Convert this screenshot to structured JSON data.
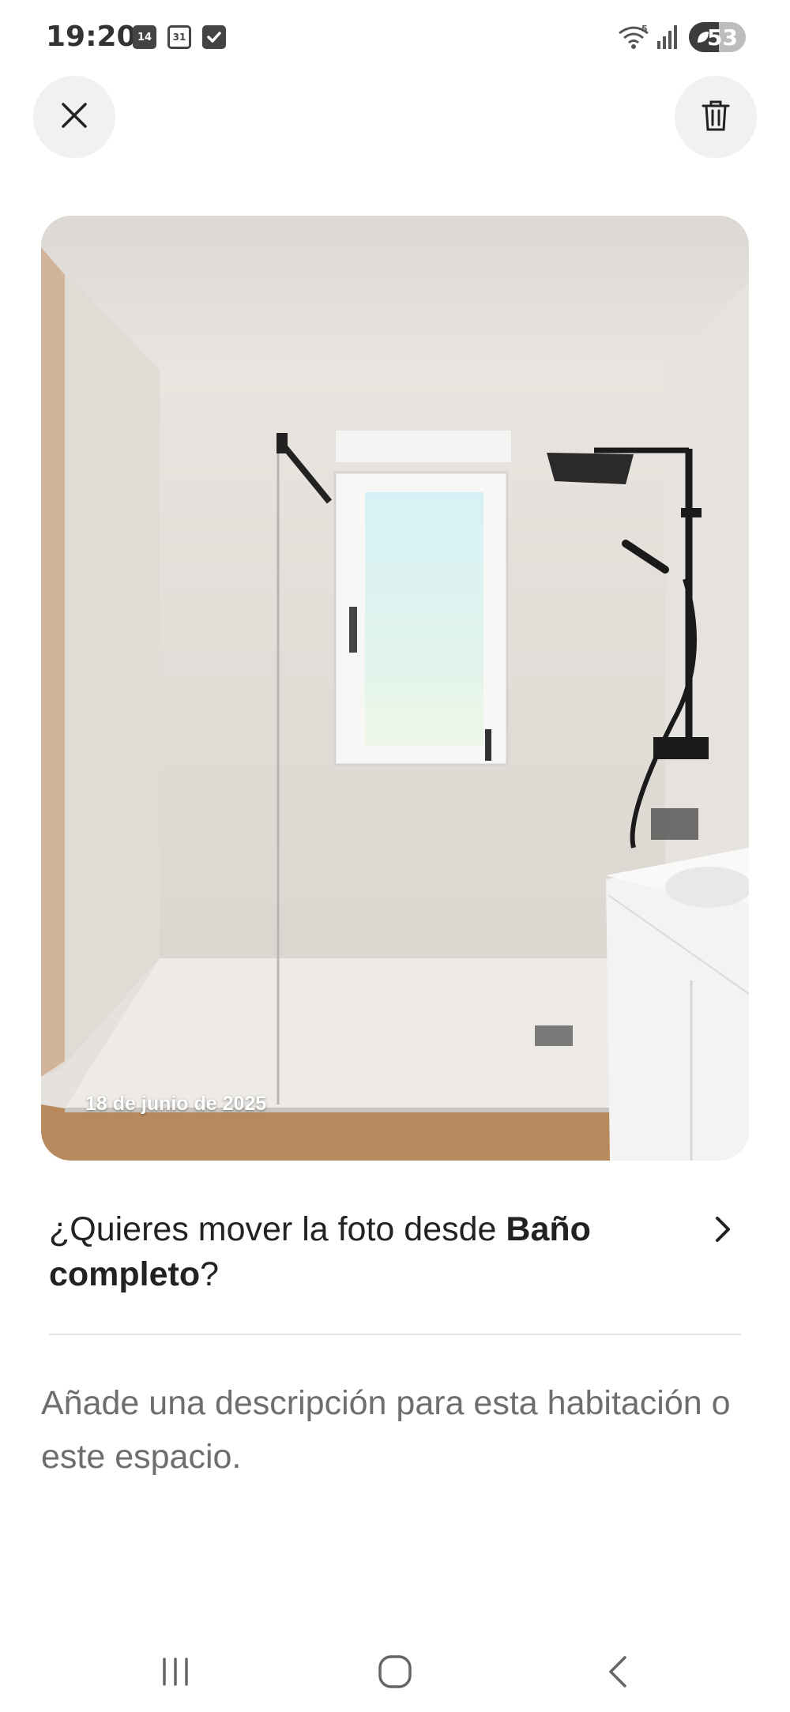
{
  "status_bar": {
    "time": "19:20",
    "calendar_day": "14",
    "calendar_month_day": "31",
    "battery_level": "53"
  },
  "toolbar": {
    "close_icon": "close-icon",
    "delete_icon": "trash-icon"
  },
  "photo": {
    "date_stamp": "18 de junio de 2025"
  },
  "move_prompt": {
    "prefix": "¿Quieres mover la foto desde ",
    "room_name": "Baño completo",
    "suffix": "?"
  },
  "description": {
    "placeholder": "Añade una descripción para esta habitación o este espacio."
  },
  "nav_bar": {
    "icons": [
      "recents-icon",
      "home-icon",
      "back-icon"
    ]
  },
  "colors": {
    "background": "#ffffff",
    "text_primary": "#222222",
    "text_muted": "#6e6e6e",
    "circle_button": "#f1f1f1"
  }
}
